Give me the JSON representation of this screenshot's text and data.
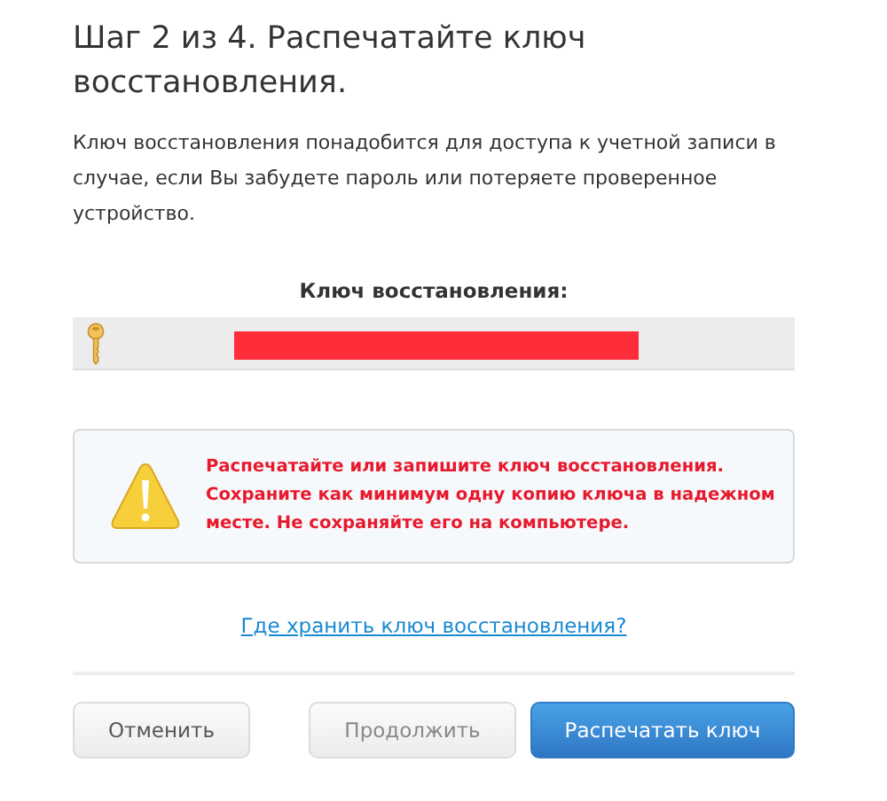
{
  "title": "Шаг 2 из 4. Распечатайте ключ восстановления.",
  "description": "Ключ восстановления понадобится для доступа к учетной записи в случае, если Вы забудете пароль или потеряете проверенное устройство.",
  "key_label": "Ключ восстановления:",
  "key_field": {
    "redacted": true
  },
  "warning": "Распечатайте или запишите ключ восстановления. Сохраните как минимум одну копию ключа в надежном месте. Не сохраняйте его на компьютере.",
  "help_link": "Где хранить ключ восстановления?",
  "buttons": [
    {
      "label": "Отменить",
      "kind": "secondary",
      "disabled": false
    },
    {
      "label": "Продолжить",
      "kind": "secondary",
      "disabled": true
    },
    {
      "label": "Распечатать ключ",
      "kind": "primary",
      "disabled": false
    }
  ]
}
